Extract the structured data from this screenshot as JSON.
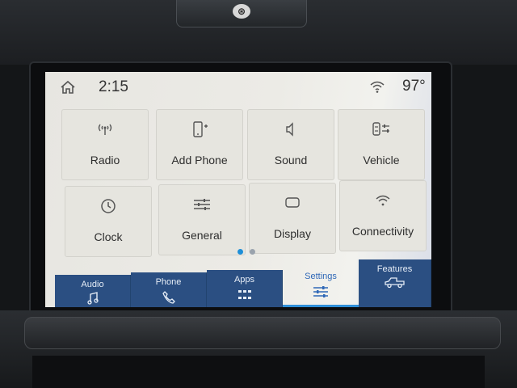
{
  "status": {
    "time": "2:15",
    "temperature": "97°"
  },
  "tiles": [
    {
      "label": "Radio",
      "icon": "radio-icon"
    },
    {
      "label": "Add Phone",
      "icon": "add-phone-icon"
    },
    {
      "label": "Sound",
      "icon": "speaker-icon"
    },
    {
      "label": "Vehicle",
      "icon": "vehicle-settings-icon"
    },
    {
      "label": "Clock",
      "icon": "clock-icon"
    },
    {
      "label": "General",
      "icon": "sliders-icon"
    },
    {
      "label": "Display",
      "icon": "display-icon"
    },
    {
      "label": "Connectivity",
      "icon": "wifi-icon"
    }
  ],
  "pager": {
    "pages": 2,
    "current": 1
  },
  "nav": [
    {
      "label": "Audio",
      "icon": "music-note-icon"
    },
    {
      "label": "Phone",
      "icon": "phone-icon"
    },
    {
      "label": "Apps",
      "icon": "grid-icon"
    },
    {
      "label": "Settings",
      "icon": "settings-sliders-icon",
      "selected": true
    },
    {
      "label": "Features",
      "icon": "truck-icon"
    }
  ],
  "colors": {
    "nav_bg": "#2b4f82",
    "accent": "#2f8fd8",
    "tile_bg": "#e6e5df"
  }
}
